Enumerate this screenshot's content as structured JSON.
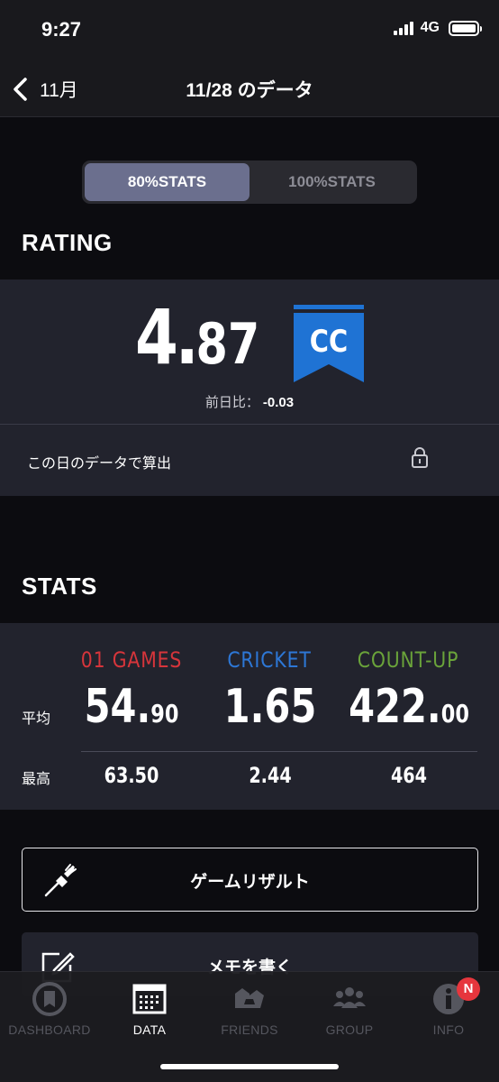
{
  "status_bar": {
    "time": "9:27",
    "network": "4G"
  },
  "nav": {
    "back_label": "11月",
    "title": "11/28 のデータ"
  },
  "segment": {
    "options": [
      "80%STATS",
      "100%STATS"
    ],
    "selected": "80%STATS"
  },
  "rating": {
    "section_title": "RATING",
    "value_int": "4",
    "value_dec": "87",
    "class_badge": "CC",
    "badge_color": "#1f73d4",
    "diff_label": "前日比：",
    "diff_value": "-0.03",
    "calc_label": "この日のデータで算出"
  },
  "stats": {
    "section_title": "STATS",
    "row_avg_label": "平均",
    "row_max_label": "最高",
    "columns": [
      {
        "name": "01 GAMES",
        "color": "#d6353b",
        "avg_int": "54.",
        "avg_dec": "90",
        "max": "63.50"
      },
      {
        "name": "CRICKET",
        "color": "#2d77d6",
        "avg_int": "1.65",
        "avg_dec": "",
        "max": "2.44"
      },
      {
        "name": "COUNT-UP",
        "color": "#6aa33a",
        "avg_int": "422.",
        "avg_dec": "00",
        "max": "464"
      }
    ]
  },
  "actions": {
    "game_result_label": "ゲームリザルト",
    "memo_label": "メモを書く"
  },
  "tabbar": {
    "items": [
      {
        "label": "DASHBOARD",
        "icon": "dashboard-icon"
      },
      {
        "label": "DATA",
        "icon": "data-icon"
      },
      {
        "label": "FRIENDS",
        "icon": "friends-icon"
      },
      {
        "label": "GROUP",
        "icon": "group-icon"
      },
      {
        "label": "INFO",
        "icon": "info-icon"
      }
    ],
    "active": "DATA",
    "info_badge": "N"
  }
}
